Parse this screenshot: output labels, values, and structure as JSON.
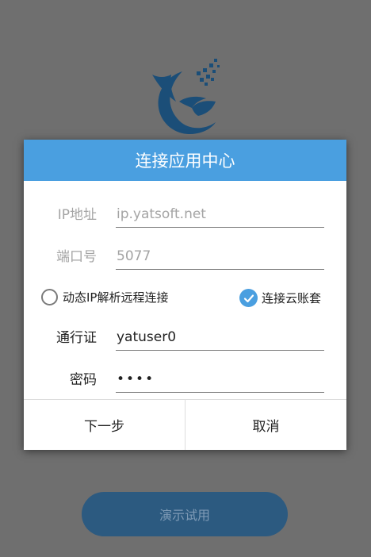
{
  "app": {
    "logo_icon": "yatsoft-logo-icon",
    "brand_color": "#1b4e78",
    "accent_color": "#4a9fe0"
  },
  "dialog": {
    "title": "连接应用中心",
    "ip_label": "IP地址",
    "ip_value": "ip.yatsoft.net",
    "port_label": "端口号",
    "port_value": "5077",
    "dynamic_ip_label": "动态IP解析远程连接",
    "dynamic_ip_checked": false,
    "cloud_label": "连接云账套",
    "cloud_checked": true,
    "pass_label": "通行证",
    "pass_value": "yatuser0",
    "password_label": "密码",
    "password_value": "••••",
    "next_label": "下一步",
    "cancel_label": "取消"
  },
  "demo_button_label": "演示试用"
}
